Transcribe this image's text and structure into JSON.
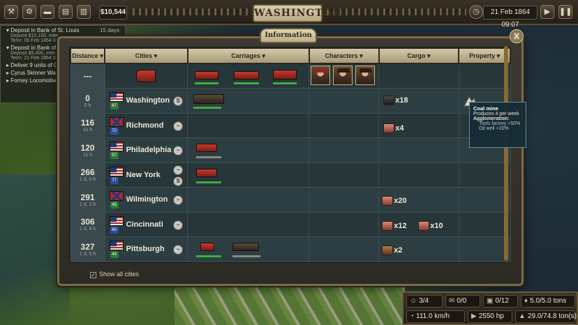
{
  "topbar": {
    "money": "$10,544",
    "city_title": "WASHINGTON",
    "date": "21 Feb 1864",
    "time": "09:07",
    "icons": [
      "wrench-icon",
      "cogs-icon",
      "train-icon",
      "book-icon",
      "chart-icon"
    ]
  },
  "left_panel": {
    "items": [
      {
        "label": "Deposit in Bank of St. Louis",
        "days": "15 days",
        "sub1": "Deposit $10,100, inter",
        "sub2": "Term: 06 Feb 1864 08:"
      },
      {
        "label": "Deposit in Bank of",
        "sub1": "Deposit $5,400, inter",
        "sub2": "Term: 21 Feb 1864 08:"
      },
      {
        "label": "Deliver 9 units of Oil"
      },
      {
        "label": "Cyrus Skinner Want"
      },
      {
        "label": "Forney Locomotive"
      }
    ]
  },
  "dialog": {
    "tab_label": "Information",
    "close_label": "X",
    "headers": {
      "distance": "Distance",
      "cities": "Cities",
      "carriages": "Carriages",
      "characters": "Characters",
      "cargo": "Cargo",
      "property": "Property"
    },
    "train_row": {
      "distance": "---"
    },
    "rows": [
      {
        "distance": "0",
        "time": "0 h",
        "city": "Washington",
        "pop": "67",
        "flag": "union",
        "city_icon": "S",
        "cargo": [
          {
            "icon": "oil",
            "qty": "x18"
          }
        ],
        "property": "mine-icon"
      },
      {
        "distance": "116",
        "time": "11 h",
        "city": "Richmond",
        "pop": "72",
        "flag": "confederate",
        "city_icon": "~",
        "cargo": [
          {
            "icon": "meat",
            "qty": "x4"
          }
        ]
      },
      {
        "distance": "120",
        "time": "11 h",
        "city": "Philadelphia",
        "pop": "57",
        "flag": "union",
        "city_icon": "~",
        "cargo": []
      },
      {
        "distance": "266",
        "time": "1 d, 0 h",
        "city": "New York",
        "pop": "77",
        "flag": "union",
        "city_icon": "S",
        "cargo": []
      },
      {
        "distance": "291",
        "time": "1 d, 2 h",
        "city": "Wilmington",
        "pop": "45",
        "flag": "confederate",
        "city_icon": "~",
        "cargo": [
          {
            "icon": "meat",
            "qty": "x20"
          }
        ]
      },
      {
        "distance": "306",
        "time": "1 d, 4 h",
        "city": "Cincinnati",
        "pop": "80",
        "flag": "union",
        "city_icon": "~",
        "cargo": [
          {
            "icon": "meat",
            "qty": "x12"
          },
          {
            "icon": "meat",
            "qty": "x10"
          }
        ]
      },
      {
        "distance": "327",
        "time": "1 d, 5 h",
        "city": "Pittsburgh",
        "pop": "44",
        "flag": "union",
        "city_icon": "~",
        "cargo": [
          {
            "icon": "wood",
            "qty": "x2"
          }
        ]
      }
    ],
    "show_all_label": "Show all cities",
    "show_all_checked": true
  },
  "tooltip": {
    "title": "Coal mine",
    "line2": "Produces 4 per week",
    "line3": "Agglomeration:",
    "line4": "Tools factory +50%",
    "line5": "Oil well +20%"
  },
  "stats": {
    "passengers": "3/4",
    "mail": "0/0",
    "cargo_cars": "0/12",
    "weight": "5.0/5.0 tons",
    "speed": "111.0 km/h",
    "power": "2550 hp",
    "load": "29.0/74.8 ton(s)"
  },
  "colors": {
    "accent": "#d4c8a6",
    "green_bar": "#3ab040",
    "panel": "#26363a"
  }
}
